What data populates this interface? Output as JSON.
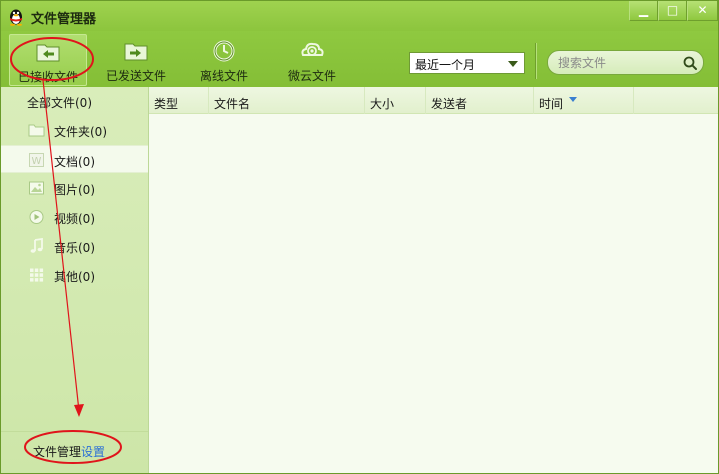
{
  "window": {
    "title": "文件管理器",
    "controls": {
      "minimize": "▁",
      "maximize": "□",
      "close": "✕"
    }
  },
  "toolbar": {
    "tools": [
      {
        "label": "已接收文件",
        "icon": "received-files-icon",
        "active": true
      },
      {
        "label": "已发送文件",
        "icon": "sent-files-icon",
        "active": false
      },
      {
        "label": "离线文件",
        "icon": "offline-files-icon",
        "active": false
      },
      {
        "label": "微云文件",
        "icon": "weiyun-cloud-icon",
        "active": false
      }
    ],
    "date_filter": {
      "selected": "最近一个月"
    },
    "search": {
      "placeholder": "搜索文件",
      "icon": "search-icon"
    }
  },
  "sidebar": {
    "all_files": "全部文件(0)",
    "items": [
      {
        "label": "文件夹(0)",
        "icon": "folder-icon"
      },
      {
        "label": "文档(0)",
        "icon": "document-icon",
        "selected": true
      },
      {
        "label": "图片(0)",
        "icon": "image-icon"
      },
      {
        "label": "视频(0)",
        "icon": "video-icon"
      },
      {
        "label": "音乐(0)",
        "icon": "music-icon"
      },
      {
        "label": "其他(0)",
        "icon": "other-grid-icon"
      }
    ],
    "footer": {
      "text": "文件管理",
      "link": "设置"
    }
  },
  "file_list": {
    "columns": [
      "类型",
      "文件名",
      "大小",
      "发送者",
      "时间"
    ],
    "sorted_column": "时间",
    "rows": []
  },
  "colors": {
    "theme_green": "#8ec63f",
    "sidebar_bg": "#d9edba",
    "list_bg": "#f6fbef",
    "link_blue": "#2a6ed6",
    "annotation_red": "#e0141b"
  }
}
